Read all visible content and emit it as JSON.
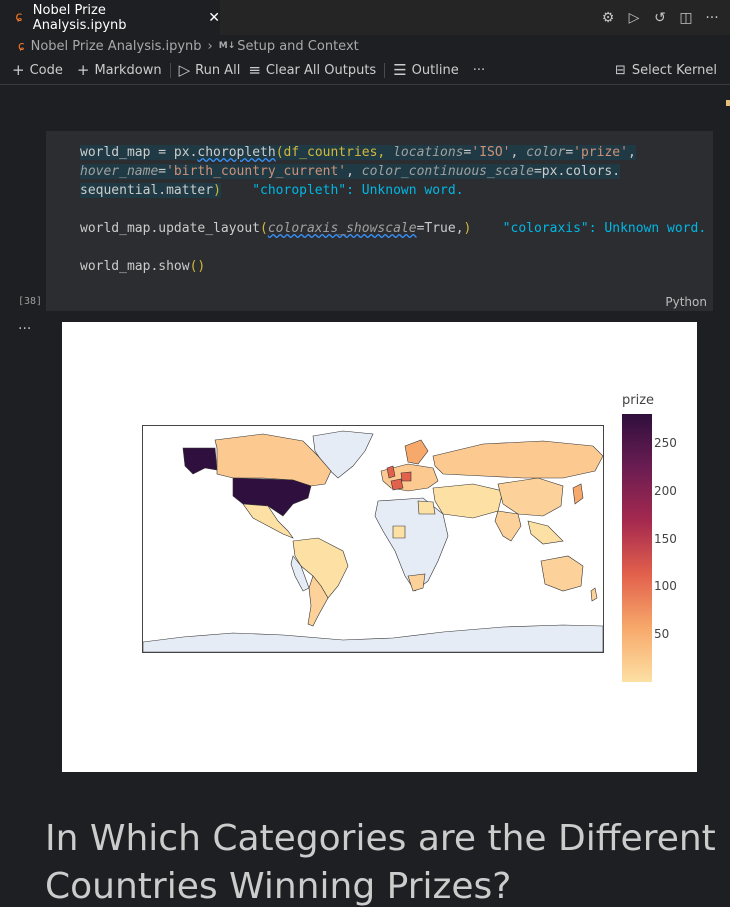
{
  "tab": {
    "title": "Nobel Prize Analysis.ipynb",
    "close": "✕",
    "icon": "jupyter-icon"
  },
  "tab_actions": {
    "settings": "⚙",
    "run": "▷",
    "history": "↺",
    "split": "◫",
    "more": "···"
  },
  "breadcrumb": {
    "file": "Nobel Prize Analysis.ipynb",
    "md_tag": "M↓",
    "section": "Setup and Context"
  },
  "toolbar": {
    "code_label": "Code",
    "markdown_label": "Markdown",
    "run_all_label": "Run All",
    "clear_label": "Clear All Outputs",
    "outline_label": "Outline",
    "more_label": "···",
    "kernel_label": "Select Kernel"
  },
  "cell": {
    "exec_count": "[38]",
    "language": "Python",
    "code": {
      "l1": [
        "world_map = px.",
        "choropleth",
        "(df_countries, ",
        "locations",
        "=",
        "'ISO'",
        ", ",
        "color",
        "=",
        "'prize'",
        ","
      ],
      "l2": [
        "hover_name",
        "=",
        "'birth_country_current'",
        ", ",
        "color_continuous_scale",
        "=px.colors."
      ],
      "l3": [
        "sequential.matter",
        ")",
        "    \"choropleth\": Unknown word."
      ],
      "l5": [
        "world_map.update_layout",
        "(",
        "coloraxis_showscale",
        "=True,",
        ")",
        "    \"coloraxis\": Unknown word."
      ],
      "l7": [
        "world_map.show",
        "()"
      ]
    }
  },
  "output": {
    "menu": "···"
  },
  "chart_data": {
    "type": "choropleth",
    "colorbar_title": "prize",
    "colorscale": "matter",
    "colorbar_ticks": [
      "250",
      "200",
      "150",
      "100",
      "50"
    ],
    "colorbar_tick_values": [
      250,
      200,
      150,
      100,
      50
    ],
    "range": [
      1,
      281
    ],
    "colors": {
      "max": "#2f0f3d",
      "high": "#a5294f",
      "mid": "#e2614c",
      "low": "#fde0a4",
      "nodata": "#e5ecf6"
    },
    "highlights": [
      {
        "country": "USA",
        "approx_value": 281
      },
      {
        "country": "GBR",
        "approx_value": 105
      },
      {
        "country": "DEU",
        "approx_value": 84
      },
      {
        "country": "FRA",
        "approx_value": 57
      }
    ]
  },
  "markdown": {
    "heading_line1": "In Which Categories are the Different",
    "heading_line2": "Countries Winning Prizes?"
  }
}
